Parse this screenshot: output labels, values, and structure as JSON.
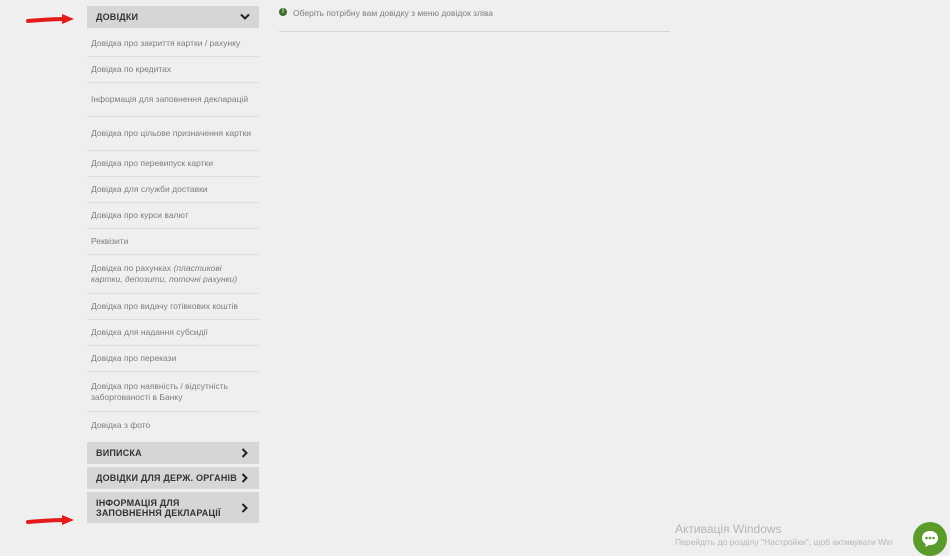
{
  "sidebar": {
    "sections": [
      {
        "label": "ДОВІДКИ",
        "items": [
          {
            "text": "Довідка про закриття картки / рахунку"
          },
          {
            "text": "Довідка по кредитах"
          },
          {
            "text": "Інформація для заповнення декларацій"
          },
          {
            "text": "Довідка про цільове призначення картки"
          },
          {
            "text": "Довідка про перевипуск картки"
          },
          {
            "text": "Довідка для служби доставки"
          },
          {
            "text": "Довідка про курси валют"
          },
          {
            "text": "Реквізити"
          },
          {
            "text": "Довідка по рахунках",
            "note": "(пластикові картки, депозити, поточні рахунки)"
          },
          {
            "text": "Довідка про видачу готівкових коштів"
          },
          {
            "text": "Довідка для надання субсидії"
          },
          {
            "text": "Довідка про перекази"
          },
          {
            "text": "Довідка про наявність / відсутність заборгованості в Банку"
          },
          {
            "text": "Довідка з фото"
          }
        ]
      },
      {
        "label": "ВИПИСКА"
      },
      {
        "label": "ДОВІДКИ ДЛЯ ДЕРЖ. ОРГАНІВ"
      },
      {
        "label": "ІНФОРМАЦІЯ ДЛЯ ЗАПОВНЕННЯ ДЕКЛАРАЦІЇ"
      }
    ]
  },
  "main": {
    "notice": "Оберіть потрібну вам довідку з меню довідок зліва"
  },
  "windows_activation": {
    "title": "Активація Windows",
    "subtitle": "Перейдіть до розділу \"Настройки\", щоб активувати Win"
  },
  "icons": {
    "annotation_arrow": "red-arrow-icon",
    "expand": "chevron-down-icon",
    "collapsed": "chevron-right-icon",
    "info": "info-icon",
    "chat": "chat-icon"
  },
  "colors": {
    "accent_green": "#5b9b2b",
    "info_green": "#3f6b2b",
    "annotation_red": "#e31b1b"
  }
}
